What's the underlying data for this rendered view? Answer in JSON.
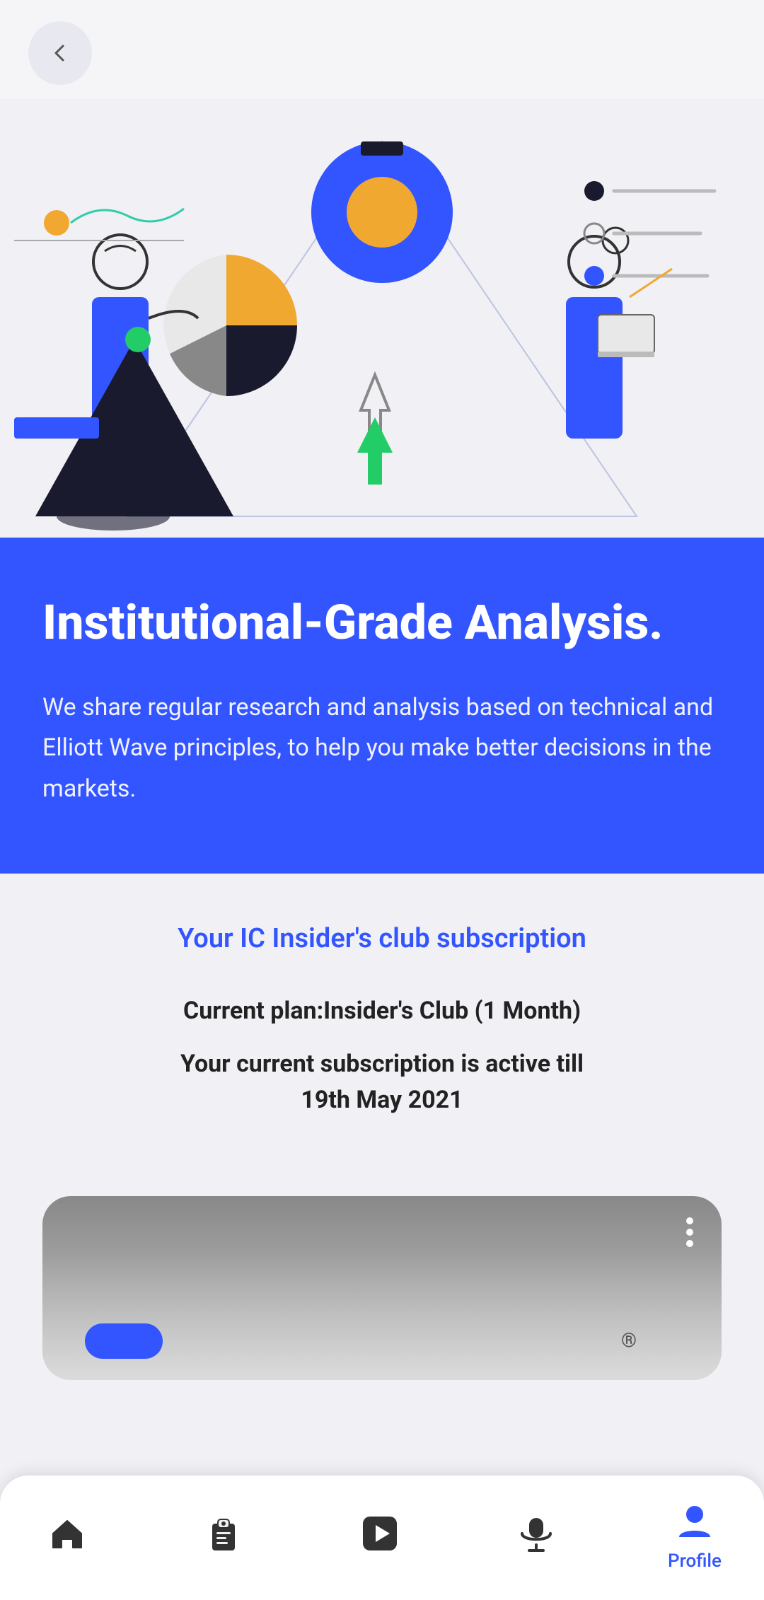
{
  "header": {
    "back_button_label": "Back"
  },
  "hero": {
    "alt": "Institutional Grade Analysis illustration"
  },
  "blue_section": {
    "title": "Institutional-Grade Analysis.",
    "description": "We share regular research and analysis based on technical and Elliott Wave principles, to help you make better decisions in the markets."
  },
  "subscription": {
    "section_title": "Your IC Insider's club subscription",
    "current_plan_label": "Current plan:",
    "current_plan_value": "Insider's Club (1 Month)",
    "active_till_line1": "Your current subscription is active till",
    "active_till_line2": "19th May 2021"
  },
  "chart_dots": {
    "dot1": "dark",
    "dot2": "outline",
    "dot3": "blue"
  },
  "bottom_nav": {
    "items": [
      {
        "id": "home",
        "label": "",
        "icon": "home-icon"
      },
      {
        "id": "reports",
        "label": "",
        "icon": "clipboard-icon"
      },
      {
        "id": "play",
        "label": "",
        "icon": "play-icon"
      },
      {
        "id": "mic",
        "label": "",
        "icon": "mic-icon"
      },
      {
        "id": "profile",
        "label": "Profile",
        "icon": "profile-icon"
      }
    ]
  }
}
